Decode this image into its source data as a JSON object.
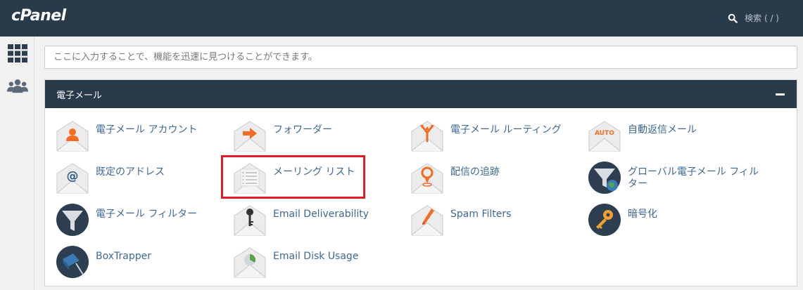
{
  "brand": {
    "logo": "cPanel"
  },
  "header": {
    "search_label": "検索 ( / )"
  },
  "sidebar": {
    "items": [
      {
        "icon": "grid-icon"
      },
      {
        "icon": "users-icon"
      }
    ]
  },
  "quick_search": {
    "placeholder": "ここに入力することで、機能を迅速に見つけることができます。"
  },
  "panel": {
    "title": "電子メール",
    "items": [
      {
        "label": "電子メール アカウント",
        "icon": "email-account-icon"
      },
      {
        "label": "フォワーダー",
        "icon": "forwarder-icon"
      },
      {
        "label": "電子メール ルーティング",
        "icon": "email-routing-icon"
      },
      {
        "label": "自動返信メール",
        "icon": "autoresponder-icon"
      },
      {
        "label": "既定のアドレス",
        "icon": "default-address-icon"
      },
      {
        "label": "メーリング リスト",
        "icon": "mailing-list-icon"
      },
      {
        "label": "配信の追跡",
        "icon": "track-delivery-icon"
      },
      {
        "label": "グローバル電子メール フィルター",
        "icon": "global-filter-icon"
      },
      {
        "label": "電子メール フィルター",
        "icon": "email-filter-icon"
      },
      {
        "label": "Email Deliverability",
        "icon": "deliverability-icon"
      },
      {
        "label": "Spam Filters",
        "icon": "spam-filters-icon"
      },
      {
        "label": "暗号化",
        "icon": "encryption-icon"
      },
      {
        "label": "BoxTrapper",
        "icon": "boxtrapper-icon"
      },
      {
        "label": "Email Disk Usage",
        "icon": "disk-usage-icon"
      }
    ]
  },
  "colors": {
    "header": "#293a4a",
    "link": "#3d6994",
    "highlight": "#e41d2d",
    "accent": "#f36c23"
  }
}
